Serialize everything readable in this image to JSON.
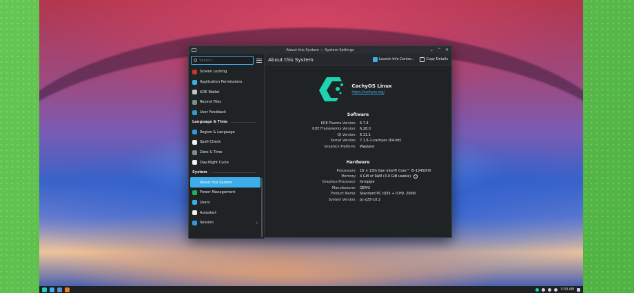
{
  "window": {
    "title": "About this System — System Settings",
    "controls": [
      "⌄",
      "⌃",
      "✕"
    ]
  },
  "search": {
    "placeholder": "Search..."
  },
  "sidebar": {
    "items_top": [
      {
        "label": "Screen Locking",
        "icon": "screen-lock-icon",
        "color": "#c0392b"
      },
      {
        "label": "Application Permissions",
        "icon": "shield-icon",
        "color": "#3daee9"
      },
      {
        "label": "KDE Wallet",
        "icon": "wallet-icon",
        "color": "#bdc3c7"
      },
      {
        "label": "Recent Files",
        "icon": "clock-icon",
        "color": "#7f8c8d"
      },
      {
        "label": "User Feedback",
        "icon": "feedback-icon",
        "color": "#3498db"
      }
    ],
    "section_language": "Language & Time",
    "items_language": [
      {
        "label": "Region & Language",
        "icon": "flag-icon",
        "color": "#3498db"
      },
      {
        "label": "Spell Check",
        "icon": "spellcheck-icon",
        "color": "#ecf0f1"
      },
      {
        "label": "Date & Time",
        "icon": "clock-icon",
        "color": "#7f8c8d"
      },
      {
        "label": "Day-Night Cycle",
        "icon": "day-night-icon",
        "color": "#ecf0f1"
      }
    ],
    "section_system": "System",
    "items_system": [
      {
        "label": "About this System",
        "icon": "info-icon",
        "color": "#3daee9",
        "active": true
      },
      {
        "label": "Power Management",
        "icon": "power-icon",
        "color": "#27ae60"
      },
      {
        "label": "Users",
        "icon": "users-icon",
        "color": "#3daee9"
      },
      {
        "label": "Autostart",
        "icon": "autostart-icon",
        "color": "#ecf0f1"
      },
      {
        "label": "Session",
        "icon": "session-icon",
        "color": "#3498db",
        "chevron": "›"
      }
    ]
  },
  "header": {
    "title": "About this System",
    "launch_info": "Launch Info Center...",
    "copy_details": "Copy Details"
  },
  "distro": {
    "name": "CachyOS Linux",
    "url": "https://cachyos.org/",
    "logo_color": "#1dd3b0"
  },
  "software": {
    "title": "Software",
    "rows": [
      {
        "k": "KDE Plasma Version:",
        "v": "6.7.4"
      },
      {
        "k": "KDE Frameworks Version:",
        "v": "6.28.0"
      },
      {
        "k": "Qt Version:",
        "v": "6.11.1"
      },
      {
        "k": "Kernel Version:",
        "v": "7.1.6-1-cachyos (64-bit)"
      },
      {
        "k": "Graphics Platform:",
        "v": "Wayland"
      }
    ]
  },
  "hardware": {
    "title": "Hardware",
    "rows": [
      {
        "k": "Processors:",
        "v": "16 × 13th Gen Intel® Core™ i5-13450HX"
      },
      {
        "k": "Memory:",
        "v": "4 GiB of RAM (3.0 GiB usable)"
      },
      {
        "k": "Graphics Processor:",
        "v": "llvmpipe"
      },
      {
        "k": "Manufacturer:",
        "v": "QEMU"
      },
      {
        "k": "Product Name:",
        "v": "Standard PC (Q35 + ICH9, 2009)"
      },
      {
        "k": "System Version:",
        "v": "pc-q35-10.2"
      }
    ]
  },
  "taskbar": {
    "clock": "3:30 AM"
  }
}
